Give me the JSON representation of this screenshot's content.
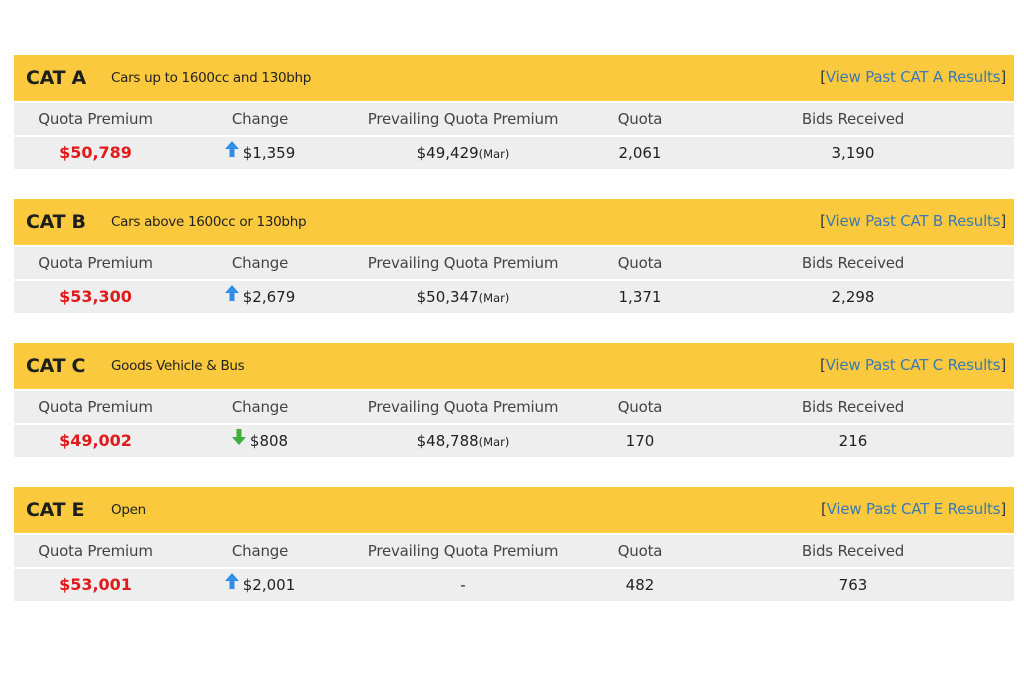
{
  "columns": {
    "quota_premium": "Quota Premium",
    "change": "Change",
    "prevailing": "Prevailing Quota Premium",
    "quota": "Quota",
    "bids": "Bids Received"
  },
  "categories": [
    {
      "title": "CAT A",
      "description": "Cars up to 1600cc and 130bhp",
      "link_open": "[",
      "link_label": "View Past CAT A Results",
      "link_close": "]",
      "quota_premium": "$50,789",
      "change_direction": "up",
      "change": "$1,359",
      "prevailing": "$49,429",
      "prevailing_suffix": "(Mar)",
      "quota": "2,061",
      "bids": "3,190"
    },
    {
      "title": "CAT B",
      "description": "Cars above 1600cc or 130bhp",
      "link_open": "[",
      "link_label": "View Past CAT B Results",
      "link_close": "]",
      "quota_premium": "$53,300",
      "change_direction": "up",
      "change": "$2,679",
      "prevailing": "$50,347",
      "prevailing_suffix": "(Mar)",
      "quota": "1,371",
      "bids": "2,298"
    },
    {
      "title": "CAT C",
      "description": "Goods Vehicle & Bus",
      "link_open": "[",
      "link_label": "View Past CAT C Results",
      "link_close": "]",
      "quota_premium": "$49,002",
      "change_direction": "down",
      "change": "$808",
      "prevailing": "$48,788",
      "prevailing_suffix": "(Mar)",
      "quota": "170",
      "bids": "216"
    },
    {
      "title": "CAT E",
      "description": "Open",
      "link_open": "[",
      "link_label": "View Past CAT E Results",
      "link_close": "]",
      "quota_premium": "$53,001",
      "change_direction": "up",
      "change": "$2,001",
      "prevailing": "-",
      "prevailing_suffix": "",
      "quota": "482",
      "bids": "763"
    }
  ],
  "colors": {
    "header_bg": "#fbc93d",
    "row_bg": "#eeeeee",
    "premium_text": "#e11b1b",
    "link_text": "#3b79b6",
    "arrow_up": "#2f8fe8",
    "arrow_down": "#3fae3f"
  },
  "icons": {
    "up": "arrow-up-icon",
    "down": "arrow-down-icon"
  }
}
